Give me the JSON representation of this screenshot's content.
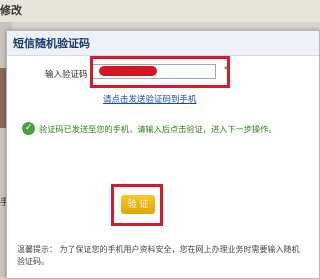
{
  "background": {
    "title_fragment": "修改",
    "left_fragment": "手",
    "button_label": "验证"
  },
  "dialog": {
    "title": "短信随机验证码",
    "input_label": "输入验证码",
    "input_value": "",
    "required_mark": "*",
    "send_link": "请点击发送验证码到手机",
    "success_message": "验证码已发送至您的手机，请输入后点击验证，进入下一步操作。",
    "verify_button": "验 证",
    "notice": "温馨提示： 为了保证您的手机用户资料安全，您在网上办理业务时需要输入随机验证码。"
  },
  "colors": {
    "highlight": "#d81b2b",
    "link": "#1c47b6",
    "success": "#2f7d1a",
    "button": "#e5b400"
  }
}
